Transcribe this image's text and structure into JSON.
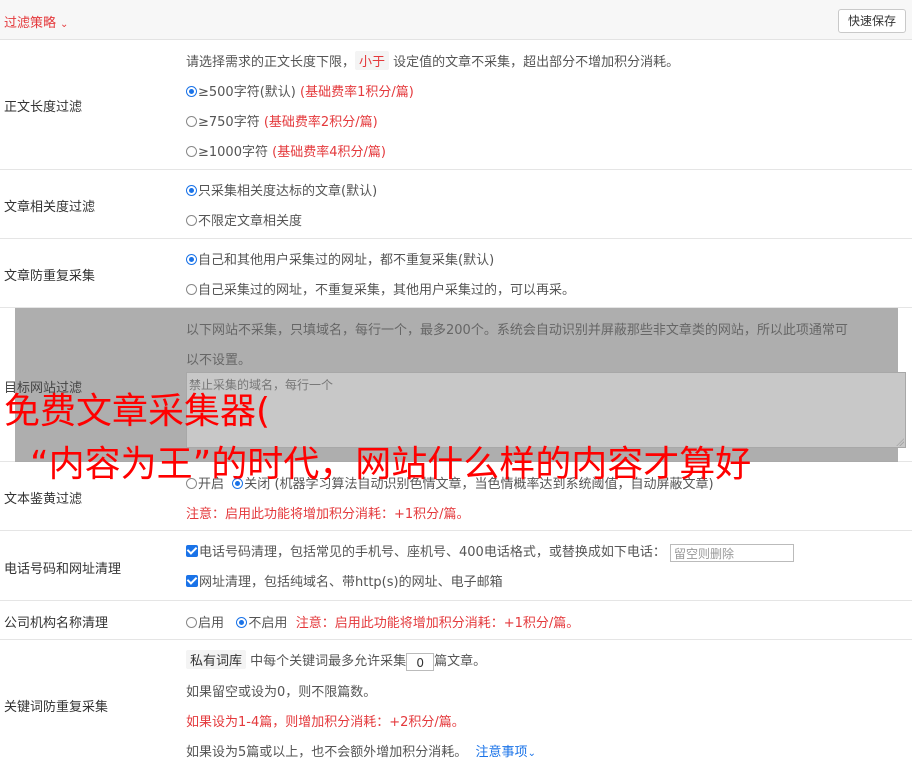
{
  "header": {
    "title": "过滤策略",
    "quick_save": "快速保存"
  },
  "length_filter": {
    "label": "正文长度过滤",
    "desc_a": "请选择需求的正文长度下限，",
    "desc_tag": "小于",
    "desc_b": "设定值的文章不采集，超出部分不增加积分消耗。",
    "opt1": "≥500字符(默认)",
    "opt1_note": "(基础费率1积分/篇)",
    "opt2": "≥750字符",
    "opt2_note": "(基础费率2积分/篇)",
    "opt3": "≥1000字符",
    "opt3_note": "(基础费率4积分/篇)"
  },
  "relevance": {
    "label": "文章相关度过滤",
    "opt1": "只采集相关度达标的文章(默认)",
    "opt2": "不限定文章相关度"
  },
  "dedupe": {
    "label": "文章防重复采集",
    "opt1": "自己和其他用户采集过的网址，都不重复采集(默认)",
    "opt2": "自己采集过的网址，不重复采集，其他用户采集过的，可以再采。"
  },
  "site_filter": {
    "label": "目标网站过滤",
    "desc1": "以下网站不采集，只填域名，每行一个，最多200个。系统会自动识别并屏蔽那些非文章类的网站，所以此项通常可",
    "desc2": "以不设置。",
    "placeholder": "禁止采集的域名，每行一个"
  },
  "porn_filter": {
    "label": "文本鉴黄过滤",
    "opt_on": "开启",
    "opt_off": "关闭",
    "desc": "(机器学习算法自动识别色情文章，当色情概率达到系统阈值，自动屏蔽文章)",
    "note": "注意：启用此功能将增加积分消耗：+1积分/篇。"
  },
  "phone_clean": {
    "label": "电话号码和网址清理",
    "opt1": "电话号码清理，包括常见的手机号、座机号、400电话格式，或替换成如下电话：",
    "input_placeholder": "留空则删除",
    "opt2": "网址清理，包括纯域名、带http(s)的网址、电子邮箱"
  },
  "company_clean": {
    "label": "公司机构名称清理",
    "opt_on": "启用",
    "opt_off": "不启用",
    "note": "注意：启用此功能将增加积分消耗：+1积分/篇。"
  },
  "keyword_dedupe": {
    "label": "关键词防重复采集",
    "tag": "私有词库",
    "line1_a": "中每个关键词最多允许采集",
    "line1_value": "0",
    "line1_b": "篇文章。",
    "line2": "如果留空或设为0，则不限篇数。",
    "line3": "如果设为1-4篇，则增加积分消耗：+2积分/篇。",
    "line4": "如果设为5篇或以上，也不会额外增加积分消耗。",
    "link": "注意事项"
  },
  "watermark": {
    "line1": "免费文章采集器(",
    "line2": "“内容为王”的时代，网站什么样的内容才算好"
  }
}
